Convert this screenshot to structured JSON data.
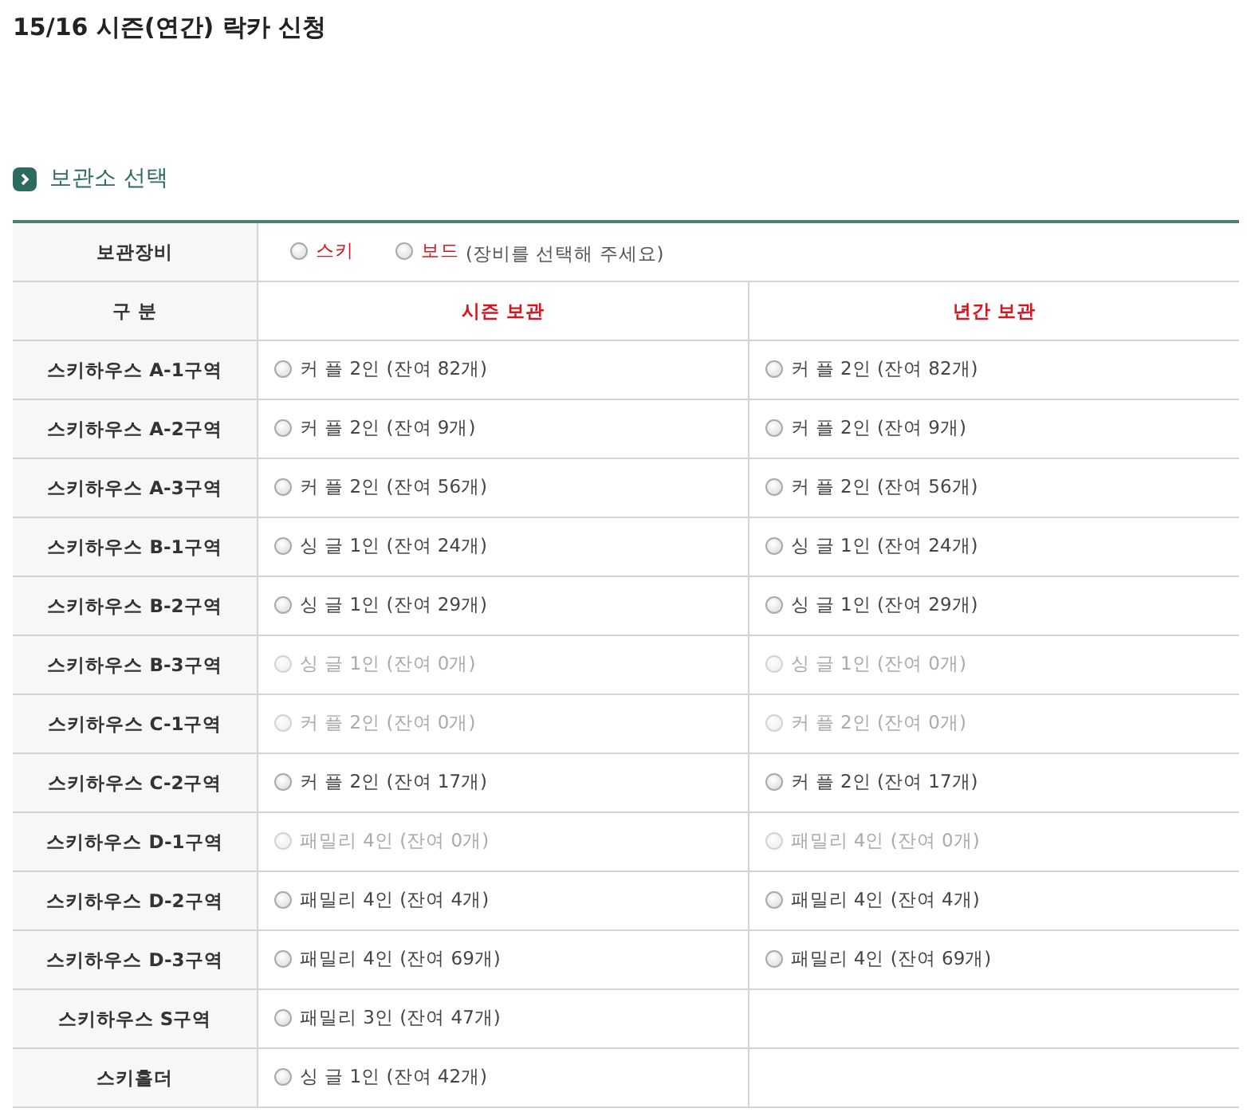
{
  "title": "15/16 시즌(연간) 락카 신청",
  "section": {
    "title": "보관소 선택"
  },
  "equipment": {
    "label": "보관장비",
    "options": [
      {
        "label": "스키",
        "selected": false
      },
      {
        "label": "보드",
        "selected": false
      }
    ],
    "hint": "(장비를 선택해 주세요)"
  },
  "columns": [
    "구 분",
    "시즌 보관",
    "년간 보관"
  ],
  "rows": [
    {
      "name": "스키하우스 A-1구역",
      "season": {
        "label": "커 플 2인 (잔여 82개)",
        "selected": false,
        "disabled": false
      },
      "annual": {
        "label": "커 플 2인 (잔여 82개)",
        "selected": false,
        "disabled": false
      }
    },
    {
      "name": "스키하우스 A-2구역",
      "season": {
        "label": "커 플 2인 (잔여 9개)",
        "selected": false,
        "disabled": false
      },
      "annual": {
        "label": "커 플 2인 (잔여 9개)",
        "selected": false,
        "disabled": false
      }
    },
    {
      "name": "스키하우스 A-3구역",
      "season": {
        "label": "커 플 2인 (잔여 56개)",
        "selected": false,
        "disabled": false
      },
      "annual": {
        "label": "커 플 2인 (잔여 56개)",
        "selected": false,
        "disabled": false
      }
    },
    {
      "name": "스키하우스 B-1구역",
      "season": {
        "label": "싱 글 1인 (잔여 24개)",
        "selected": false,
        "disabled": false
      },
      "annual": {
        "label": "싱 글 1인 (잔여 24개)",
        "selected": false,
        "disabled": false
      }
    },
    {
      "name": "스키하우스 B-2구역",
      "season": {
        "label": "싱 글 1인 (잔여 29개)",
        "selected": false,
        "disabled": false
      },
      "annual": {
        "label": "싱 글 1인 (잔여 29개)",
        "selected": false,
        "disabled": false
      }
    },
    {
      "name": "스키하우스 B-3구역",
      "season": {
        "label": "싱 글 1인 (잔여 0개)",
        "selected": false,
        "disabled": true
      },
      "annual": {
        "label": "싱 글 1인 (잔여 0개)",
        "selected": false,
        "disabled": true
      }
    },
    {
      "name": "스키하우스 C-1구역",
      "season": {
        "label": "커 플 2인 (잔여 0개)",
        "selected": false,
        "disabled": true
      },
      "annual": {
        "label": "커 플 2인 (잔여 0개)",
        "selected": false,
        "disabled": true
      }
    },
    {
      "name": "스키하우스 C-2구역",
      "season": {
        "label": "커 플 2인 (잔여 17개)",
        "selected": false,
        "disabled": false
      },
      "annual": {
        "label": "커 플 2인 (잔여 17개)",
        "selected": false,
        "disabled": false
      }
    },
    {
      "name": "스키하우스 D-1구역",
      "season": {
        "label": "패밀리 4인 (잔여 0개)",
        "selected": false,
        "disabled": true
      },
      "annual": {
        "label": "패밀리 4인 (잔여 0개)",
        "selected": false,
        "disabled": true
      }
    },
    {
      "name": "스키하우스 D-2구역",
      "season": {
        "label": "패밀리 4인 (잔여 4개)",
        "selected": false,
        "disabled": false
      },
      "annual": {
        "label": "패밀리 4인 (잔여 4개)",
        "selected": false,
        "disabled": false
      }
    },
    {
      "name": "스키하우스 D-3구역",
      "season": {
        "label": "패밀리 4인 (잔여 69개)",
        "selected": false,
        "disabled": false
      },
      "annual": {
        "label": "패밀리 4인 (잔여 69개)",
        "selected": false,
        "disabled": false
      }
    },
    {
      "name": "스키하우스 S구역",
      "season": {
        "label": "패밀리 3인 (잔여 47개)",
        "selected": false,
        "disabled": false
      }
    },
    {
      "name": "스키홀더",
      "season": {
        "label": "싱 글 1인 (잔여 42개)",
        "selected": false,
        "disabled": false
      }
    }
  ]
}
